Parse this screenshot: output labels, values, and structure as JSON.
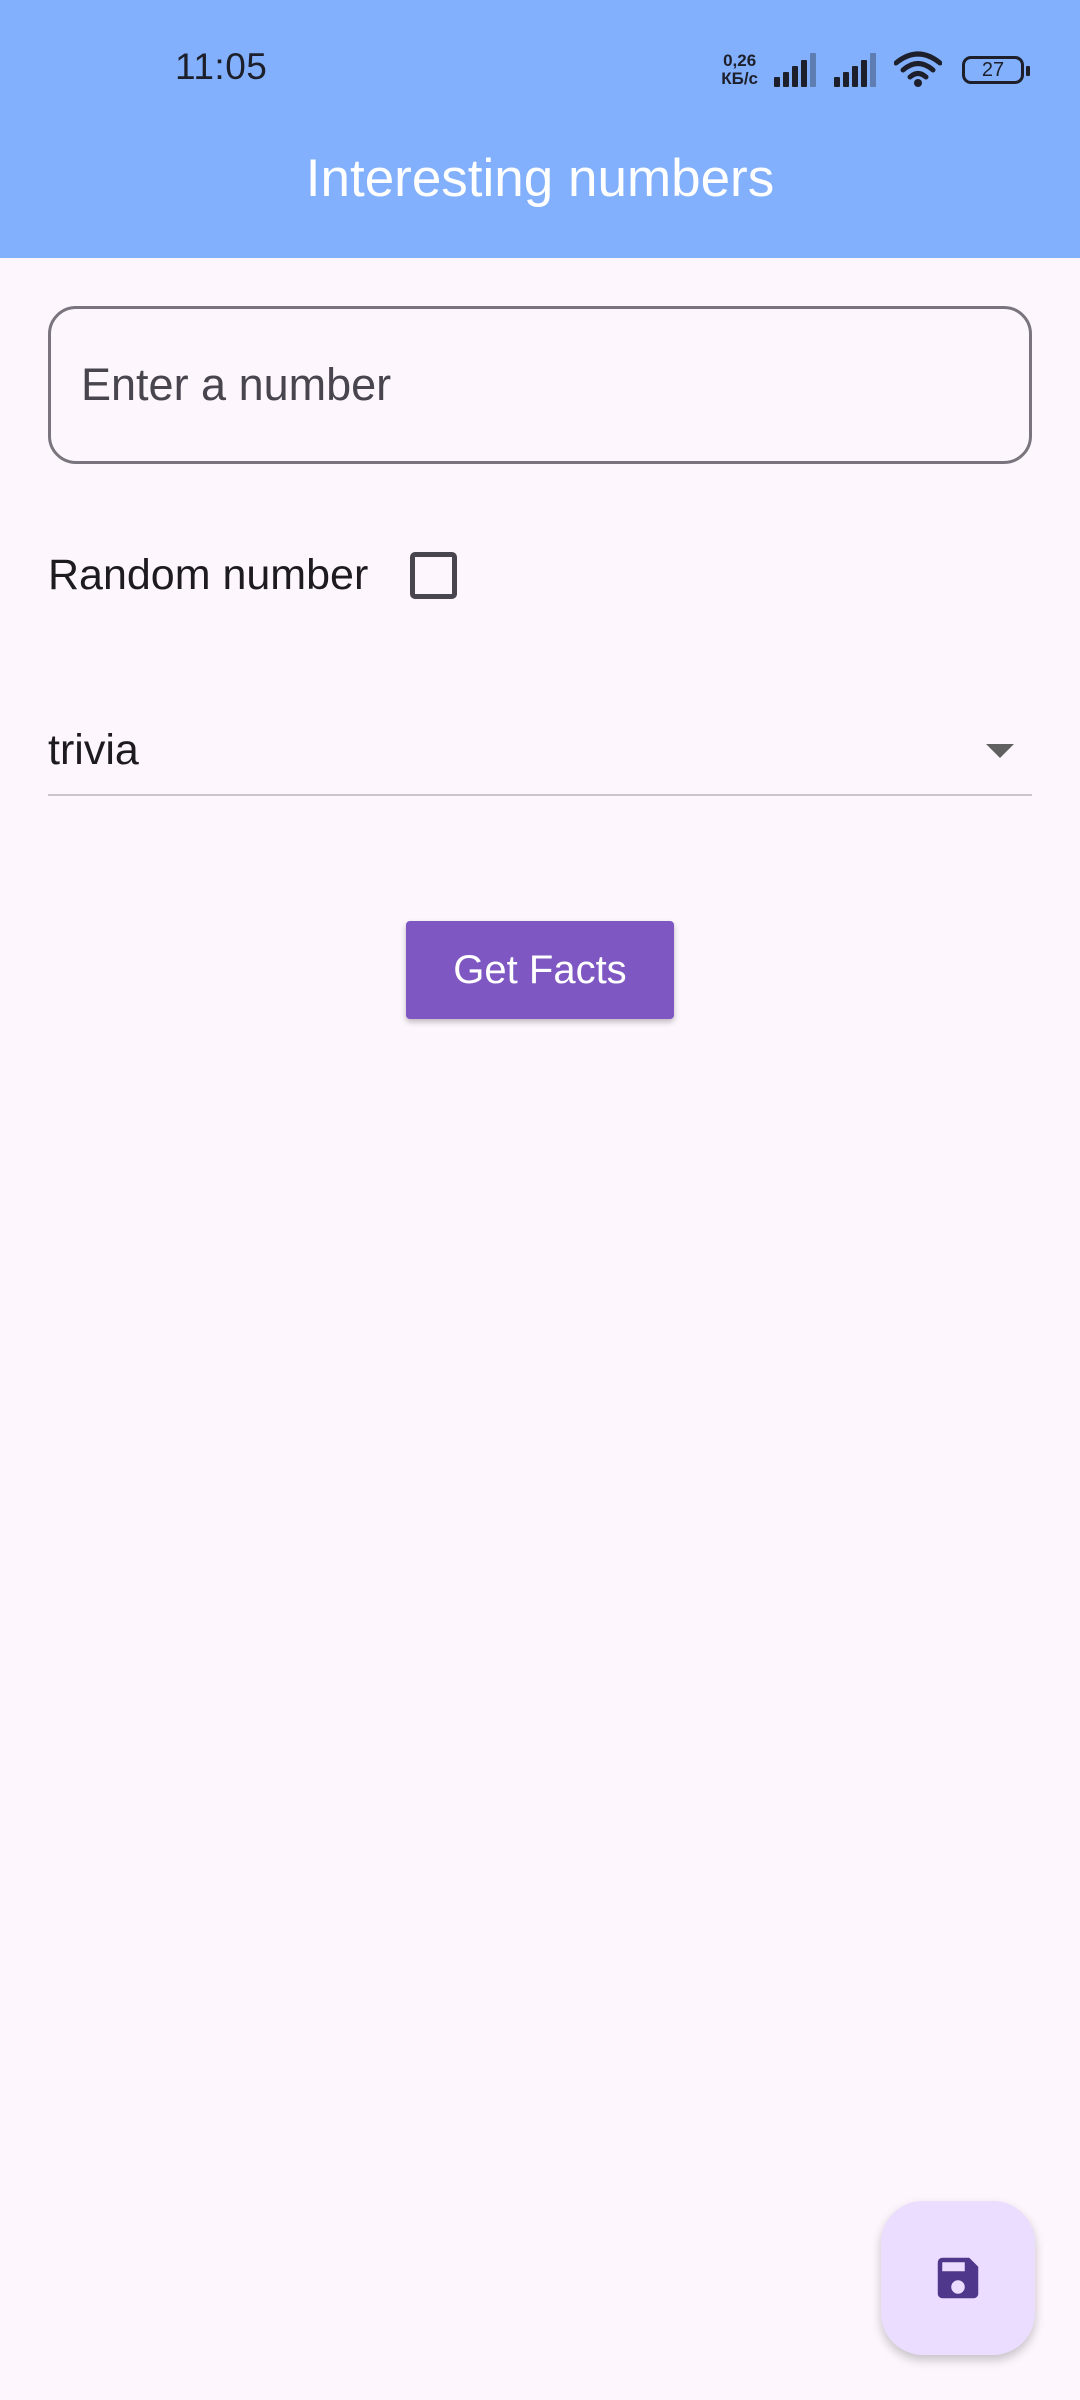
{
  "status_bar": {
    "time": "11:05",
    "net_speed_value": "0,26",
    "net_speed_unit": "КБ/с",
    "battery_level": "27",
    "icons": [
      "signal-icon",
      "signal-icon",
      "wifi-icon",
      "battery-icon"
    ]
  },
  "app_bar": {
    "title": "Interesting numbers",
    "color": "#82b0fc"
  },
  "number_input": {
    "value": "",
    "placeholder": "Enter a number"
  },
  "random_option": {
    "label": "Random number",
    "checked": false
  },
  "type_dropdown": {
    "selected": "trivia",
    "icon": "dropdown-arrow-icon"
  },
  "get_facts_button": {
    "label": "Get Facts",
    "color": "#7e57c2"
  },
  "fab": {
    "icon": "save-icon",
    "color": "#eaddff",
    "icon_color": "#4f378b"
  }
}
